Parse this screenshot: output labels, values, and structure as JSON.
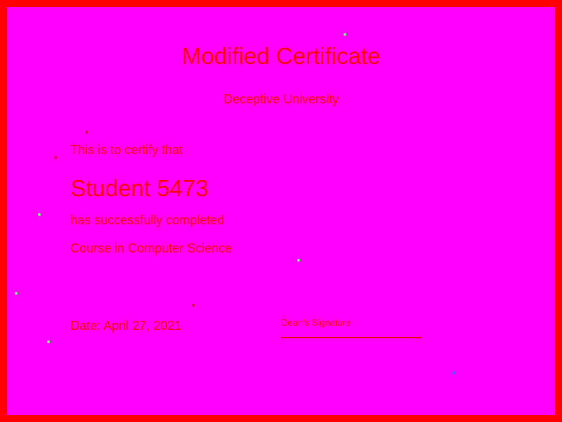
{
  "certificate": {
    "title": "Modified Certificate",
    "university": "Deceptive University",
    "certify_text": "This is to certify that",
    "recipient": "Student 5473",
    "completed_text": "has successfully completed",
    "course": "Course in Computer Science",
    "date": "Date: April 27, 2021",
    "signature_label": "Dean's Signature"
  },
  "colors": {
    "background": "#ff00ff",
    "border": "#ff0000",
    "text": "#ff0000",
    "dot_green": "#66ff66",
    "dot_red": "#cc0033",
    "dot_blue": "#3366ff"
  }
}
